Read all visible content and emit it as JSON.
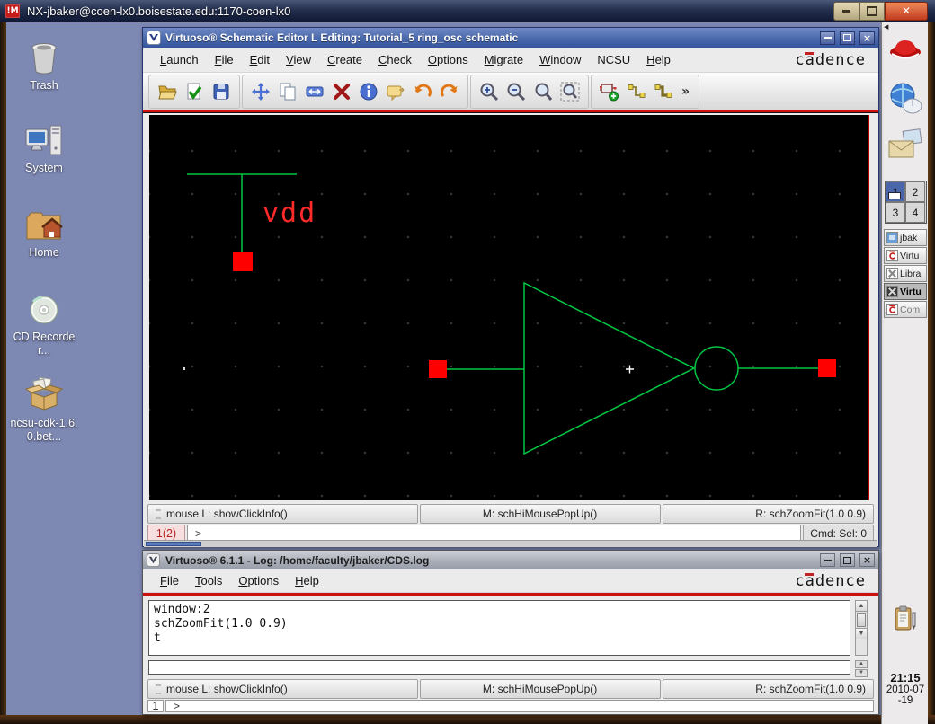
{
  "nx": {
    "title": "NX-jbaker@coen-lx0.boisestate.edu:1170-coen-lx0",
    "icon_text": "!M"
  },
  "desktop": {
    "icons": [
      {
        "name": "trash",
        "label": "Trash"
      },
      {
        "name": "system",
        "label": "System"
      },
      {
        "name": "home",
        "label": "Home"
      },
      {
        "name": "cd-recorder",
        "label": "CD Recorder..."
      },
      {
        "name": "ncsu-cdk-package",
        "label": "ncsu-cdk-1.6.0.bet..."
      }
    ]
  },
  "schematic": {
    "title": "Virtuoso® Schematic Editor L Editing: Tutorial_5 ring_osc schematic",
    "menus": [
      "Launch",
      "File",
      "Edit",
      "View",
      "Create",
      "Check",
      "Options",
      "Migrate",
      "Window",
      "NCSU",
      "Help"
    ],
    "brand": "cadence",
    "toolbar_icons": [
      "open",
      "check-and-save",
      "save",
      "move",
      "copy",
      "stretch",
      "delete",
      "properties",
      "descend",
      "undo",
      "redo",
      "zoom-in",
      "zoom-out",
      "zoom",
      "zoom-fit",
      "create-instance",
      "create-narrow-wire",
      "create-wide-wire",
      "more"
    ],
    "statusbar": {
      "left": "mouse L: showClickInfo()",
      "middle": "M: schHiMousePopUp()",
      "right": "R: schZoomFit(1.0 0.9)"
    },
    "prompt": {
      "line_label": "1(2)",
      "input": ">",
      "selection": "Cmd: Sel: 0"
    },
    "canvas": {
      "net_label": "vdd",
      "wire_color": "#00c544",
      "pin_color": "#ff0000",
      "label_color": "#ff2a2a"
    }
  },
  "log": {
    "title": "Virtuoso® 6.1.1 - Log: /home/faculty/jbaker/CDS.log",
    "menus": [
      "File",
      "Tools",
      "Options",
      "Help"
    ],
    "brand": "cadence",
    "lines": [
      "window:2",
      "schZoomFit(1.0 0.9)",
      "t"
    ],
    "statusbar": {
      "left": "mouse L: showClickInfo()",
      "middle": "M: schHiMousePopUp()",
      "right": "R: schZoomFit(1.0 0.9)"
    },
    "prompt": {
      "line_label": "1",
      "input": ">"
    }
  },
  "panel": {
    "icons": [
      "red-hat",
      "web-browser",
      "email",
      "notes"
    ],
    "workspaces": [
      "1",
      "2",
      "3",
      "4"
    ],
    "active_workspace": "1",
    "window_list": [
      {
        "label": "jbak",
        "icon": "terminal"
      },
      {
        "label": "Virtu",
        "icon": "cadence"
      },
      {
        "label": "Libra",
        "icon": "library"
      },
      {
        "label": "Virtu",
        "icon": "cadence-dark",
        "active": true
      },
      {
        "label": "Com",
        "icon": "cadence"
      }
    ],
    "clock": {
      "time": "21:15",
      "date_line1": "2010-07",
      "date_line2": "-19"
    }
  }
}
